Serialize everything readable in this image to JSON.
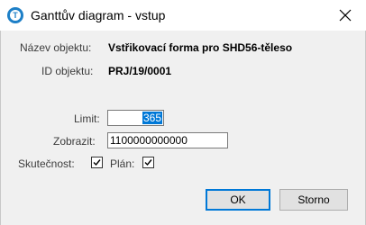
{
  "window": {
    "title": "Ganttův diagram - vstup",
    "icon": "app-logo-icon",
    "icon_letter": "T",
    "close_icon": "close-icon"
  },
  "info": {
    "object_name_label": "Název objektu:",
    "object_name_value": "Vstřikovací forma pro SHD56-těleso",
    "object_id_label": "ID objektu:",
    "object_id_value": "PRJ/19/0001"
  },
  "form": {
    "limit_label": "Limit:",
    "limit_value": "365",
    "display_label": "Zobrazit:",
    "display_value": "1100000000000",
    "actual_label": "Skutečnost:",
    "actual_checked": true,
    "plan_label": "Plán:",
    "plan_checked": true
  },
  "buttons": {
    "ok_label": "OK",
    "cancel_label": "Storno"
  },
  "colors": {
    "accent": "#0078d7",
    "app_icon": "#1d7fc7"
  }
}
